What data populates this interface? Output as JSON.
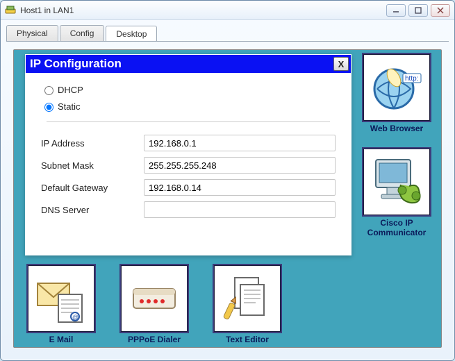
{
  "window": {
    "title": "Host1 in LAN1"
  },
  "tabs": {
    "physical": "Physical",
    "config": "Config",
    "desktop": "Desktop"
  },
  "dialog": {
    "title": "IP Configuration",
    "close": "X",
    "mode_dhcp": "DHCP",
    "mode_static": "Static",
    "labels": {
      "ip": "IP Address",
      "mask": "Subnet Mask",
      "gateway": "Default Gateway",
      "dns": "DNS Server"
    },
    "values": {
      "ip": "192.168.0.1",
      "mask": "255.255.255.248",
      "gateway": "192.168.0.14",
      "dns": ""
    }
  },
  "apps": {
    "web_browser": "Web Browser",
    "cisco_ip": "Cisco IP Communicator",
    "email": "E Mail",
    "pppoe": "PPPoE Dialer",
    "text_editor": "Text Editor"
  }
}
